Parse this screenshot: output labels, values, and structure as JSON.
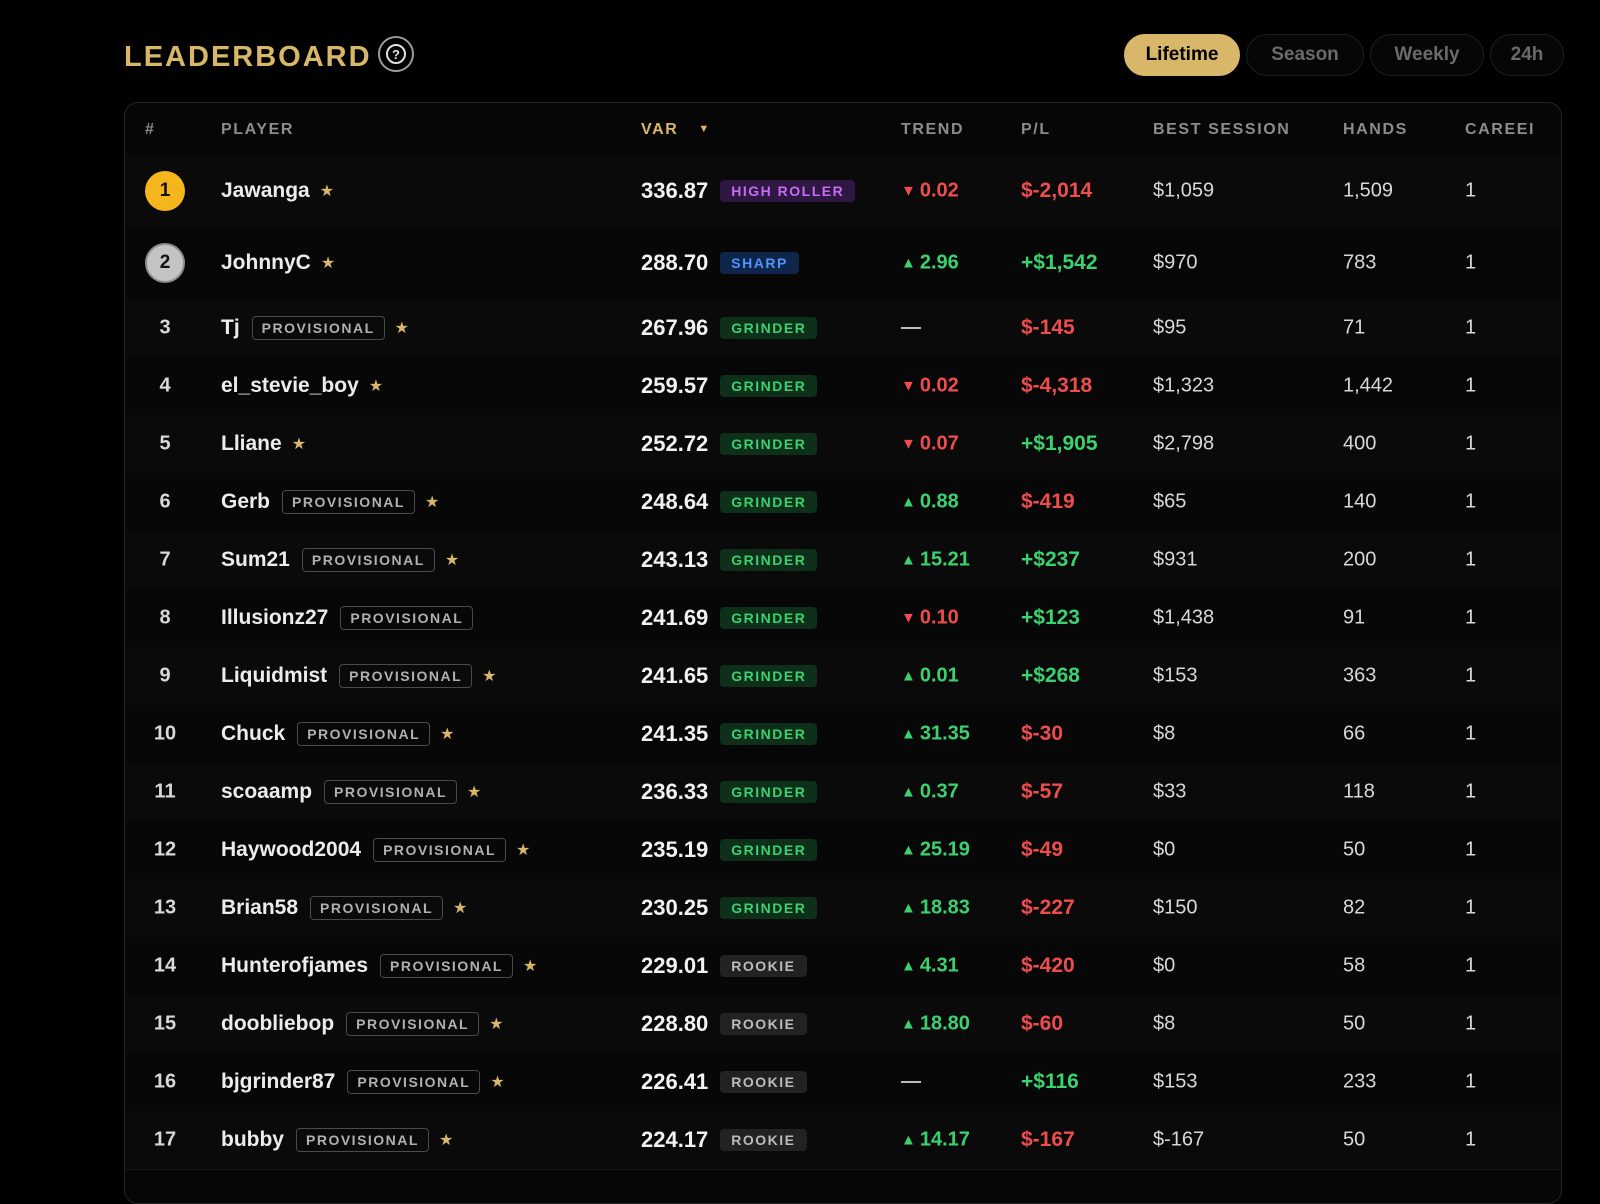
{
  "header": {
    "title": "LEADERBOARD",
    "help_icon": "?"
  },
  "tabs": [
    {
      "label": "Lifetime",
      "active": true
    },
    {
      "label": "Season",
      "active": false
    },
    {
      "label": "Weekly",
      "active": false
    },
    {
      "label": "24h",
      "active": false
    }
  ],
  "columns": {
    "rank": "#",
    "player": "PLAYER",
    "var": "VAR",
    "var_sort": "▼",
    "trend": "TREND",
    "pl": "P/L",
    "best": "BEST SESSION",
    "hands": "HANDS",
    "career": "CAREEI"
  },
  "colors": {
    "accent": "#d9b76a",
    "positive": "#3bd16f",
    "negative": "#ef4d4d",
    "gold_medal": "#f5b51c",
    "silver_medal": "#c4c4c4"
  },
  "rows": [
    {
      "rank": "1",
      "medal": "gold",
      "name": "Jawanga",
      "provisional": "",
      "star": "★",
      "var": "336.87",
      "badge": "HIGH ROLLER",
      "badge_type": "hr",
      "trend_dir": "down",
      "trend": "0.02",
      "pl": "$-2,014",
      "pl_sign": "neg",
      "best": "$1,059",
      "hands": "1,509",
      "career": "1"
    },
    {
      "rank": "2",
      "medal": "silver",
      "name": "JohnnyC",
      "provisional": "",
      "star": "★",
      "var": "288.70",
      "badge": "SHARP",
      "badge_type": "sharp",
      "trend_dir": "up",
      "trend": "2.96",
      "pl": "+$1,542",
      "pl_sign": "pos",
      "best": "$970",
      "hands": "783",
      "career": "1"
    },
    {
      "rank": "3",
      "medal": "",
      "name": "Tj",
      "provisional": "PROVISIONAL",
      "star": "★",
      "var": "267.96",
      "badge": "GRINDER",
      "badge_type": "grinder",
      "trend_dir": "flat",
      "trend": "—",
      "pl": "$-145",
      "pl_sign": "neg",
      "best": "$95",
      "hands": "71",
      "career": "1"
    },
    {
      "rank": "4",
      "medal": "",
      "name": "el_stevie_boy",
      "provisional": "",
      "star": "★",
      "var": "259.57",
      "badge": "GRINDER",
      "badge_type": "grinder",
      "trend_dir": "down",
      "trend": "0.02",
      "pl": "$-4,318",
      "pl_sign": "neg",
      "best": "$1,323",
      "hands": "1,442",
      "career": "1"
    },
    {
      "rank": "5",
      "medal": "",
      "name": "Lliane",
      "provisional": "",
      "star": "★",
      "var": "252.72",
      "badge": "GRINDER",
      "badge_type": "grinder",
      "trend_dir": "down",
      "trend": "0.07",
      "pl": "+$1,905",
      "pl_sign": "pos",
      "best": "$2,798",
      "hands": "400",
      "career": "1"
    },
    {
      "rank": "6",
      "medal": "",
      "name": "Gerb",
      "provisional": "PROVISIONAL",
      "star": "★",
      "var": "248.64",
      "badge": "GRINDER",
      "badge_type": "grinder",
      "trend_dir": "up",
      "trend": "0.88",
      "pl": "$-419",
      "pl_sign": "neg",
      "best": "$65",
      "hands": "140",
      "career": "1"
    },
    {
      "rank": "7",
      "medal": "",
      "name": "Sum21",
      "provisional": "PROVISIONAL",
      "star": "★",
      "var": "243.13",
      "badge": "GRINDER",
      "badge_type": "grinder",
      "trend_dir": "up",
      "trend": "15.21",
      "pl": "+$237",
      "pl_sign": "pos",
      "best": "$931",
      "hands": "200",
      "career": "1"
    },
    {
      "rank": "8",
      "medal": "",
      "name": "Illusionz27",
      "provisional": "PROVISIONAL",
      "star": "",
      "var": "241.69",
      "badge": "GRINDER",
      "badge_type": "grinder",
      "trend_dir": "down",
      "trend": "0.10",
      "pl": "+$123",
      "pl_sign": "pos",
      "best": "$1,438",
      "hands": "91",
      "career": "1"
    },
    {
      "rank": "9",
      "medal": "",
      "name": "Liquidmist",
      "provisional": "PROVISIONAL",
      "star": "★",
      "var": "241.65",
      "badge": "GRINDER",
      "badge_type": "grinder",
      "trend_dir": "up",
      "trend": "0.01",
      "pl": "+$268",
      "pl_sign": "pos",
      "best": "$153",
      "hands": "363",
      "career": "1"
    },
    {
      "rank": "10",
      "medal": "",
      "name": "Chuck",
      "provisional": "PROVISIONAL",
      "star": "★",
      "var": "241.35",
      "badge": "GRINDER",
      "badge_type": "grinder",
      "trend_dir": "up",
      "trend": "31.35",
      "pl": "$-30",
      "pl_sign": "neg",
      "best": "$8",
      "hands": "66",
      "career": "1"
    },
    {
      "rank": "11",
      "medal": "",
      "name": "scoaamp",
      "provisional": "PROVISIONAL",
      "star": "★",
      "var": "236.33",
      "badge": "GRINDER",
      "badge_type": "grinder",
      "trend_dir": "up",
      "trend": "0.37",
      "pl": "$-57",
      "pl_sign": "neg",
      "best": "$33",
      "hands": "118",
      "career": "1"
    },
    {
      "rank": "12",
      "medal": "",
      "name": "Haywood2004",
      "provisional": "PROVISIONAL",
      "star": "★",
      "var": "235.19",
      "badge": "GRINDER",
      "badge_type": "grinder",
      "trend_dir": "up",
      "trend": "25.19",
      "pl": "$-49",
      "pl_sign": "neg",
      "best": "$0",
      "hands": "50",
      "career": "1"
    },
    {
      "rank": "13",
      "medal": "",
      "name": "Brian58",
      "provisional": "PROVISIONAL",
      "star": "★",
      "var": "230.25",
      "badge": "GRINDER",
      "badge_type": "grinder",
      "trend_dir": "up",
      "trend": "18.83",
      "pl": "$-227",
      "pl_sign": "neg",
      "best": "$150",
      "hands": "82",
      "career": "1"
    },
    {
      "rank": "14",
      "medal": "",
      "name": "Hunterofjames",
      "provisional": "PROVISIONAL",
      "star": "★",
      "var": "229.01",
      "badge": "ROOKIE",
      "badge_type": "rookie",
      "trend_dir": "up",
      "trend": "4.31",
      "pl": "$-420",
      "pl_sign": "neg",
      "best": "$0",
      "hands": "58",
      "career": "1"
    },
    {
      "rank": "15",
      "medal": "",
      "name": "doobliebop",
      "provisional": "PROVISIONAL",
      "star": "★",
      "var": "228.80",
      "badge": "ROOKIE",
      "badge_type": "rookie",
      "trend_dir": "up",
      "trend": "18.80",
      "pl": "$-60",
      "pl_sign": "neg",
      "best": "$8",
      "hands": "50",
      "career": "1"
    },
    {
      "rank": "16",
      "medal": "",
      "name": "bjgrinder87",
      "provisional": "PROVISIONAL",
      "star": "★",
      "var": "226.41",
      "badge": "ROOKIE",
      "badge_type": "rookie",
      "trend_dir": "flat",
      "trend": "—",
      "pl": "+$116",
      "pl_sign": "pos",
      "best": "$153",
      "hands": "233",
      "career": "1"
    },
    {
      "rank": "17",
      "medal": "",
      "name": "bubby",
      "provisional": "PROVISIONAL",
      "star": "★",
      "var": "224.17",
      "badge": "ROOKIE",
      "badge_type": "rookie",
      "trend_dir": "up",
      "trend": "14.17",
      "pl": "$-167",
      "pl_sign": "neg",
      "best": "$-167",
      "hands": "50",
      "career": "1"
    }
  ]
}
